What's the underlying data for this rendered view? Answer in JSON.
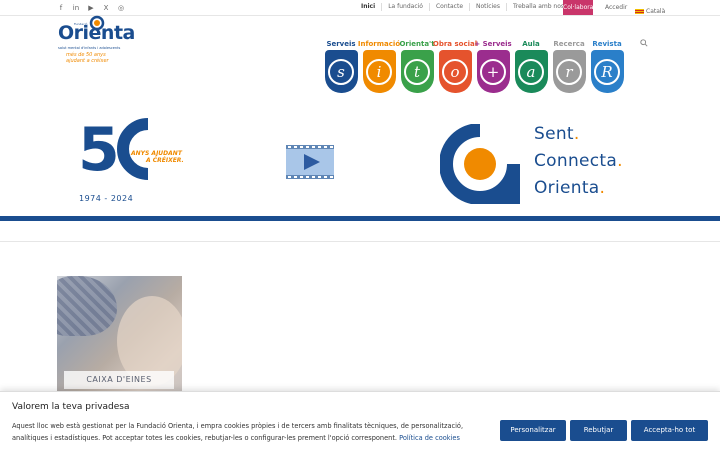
{
  "topbar": {
    "social": [
      "f",
      "in",
      "▶",
      "X",
      "◎"
    ],
    "social_names": [
      "facebook-icon",
      "linkedin-icon",
      "youtube-icon",
      "x-icon",
      "instagram-icon"
    ],
    "menu": [
      "Inici",
      "La fundació",
      "Contacte",
      "Notícies",
      "Treballa amb nosaltres"
    ],
    "collabora": "Col·labora",
    "accedir": "Accedir",
    "language": "Català"
  },
  "logo": {
    "word": "Orienta",
    "fundacio": "Fundació",
    "subtitle": "salut mental d'infants i adolescents",
    "tagline1": "més de 50 anys",
    "tagline2": "ajudant a créixer"
  },
  "nav": [
    {
      "label": "Serveis",
      "letter": "s",
      "color": "#1a4d8f"
    },
    {
      "label": "Informació",
      "letter": "i",
      "color": "#f08a00"
    },
    {
      "label": "Orienta't",
      "letter": "t",
      "color": "#3aa14a"
    },
    {
      "label": "Obra social",
      "letter": "o",
      "color": "#e5532d"
    },
    {
      "label": "+ Serveis",
      "letter": "+",
      "color": "#9b2d8e"
    },
    {
      "label": "Aula",
      "letter": "a",
      "color": "#1a8a5a"
    },
    {
      "label": "Recerca",
      "letter": "r",
      "color": "#9a9a9a"
    },
    {
      "label": "Revista",
      "letter": "R",
      "color": "#2a7fc9"
    }
  ],
  "banner": {
    "anys_line1": "ANYS AJUDANT",
    "anys_line2": "A CRÉIXER.",
    "years": "1974 - 2024",
    "sent": [
      "Sent",
      "Connecta",
      "Orienta"
    ]
  },
  "card": {
    "label": "CAIXA D'EINES"
  },
  "cookie": {
    "title": "Valorem la teva privadesa",
    "text": "Aquest lloc web està gestionat per la Fundació Orienta, i empra cookies pròpies i de tercers amb finalitats tècniques, de personalització, analítiques i estadístiques. Pot acceptar totes les cookies, rebutjar-les o configurar-les prement l'opció corresponent.",
    "link": "Política de cookies",
    "btn_customize": "Personalitzar",
    "btn_reject": "Rebutjar",
    "btn_accept": "Accepta-ho tot"
  },
  "colors": {
    "brand_blue": "#1a4d8f",
    "brand_orange": "#f08a00",
    "collabora": "#c9356a"
  }
}
